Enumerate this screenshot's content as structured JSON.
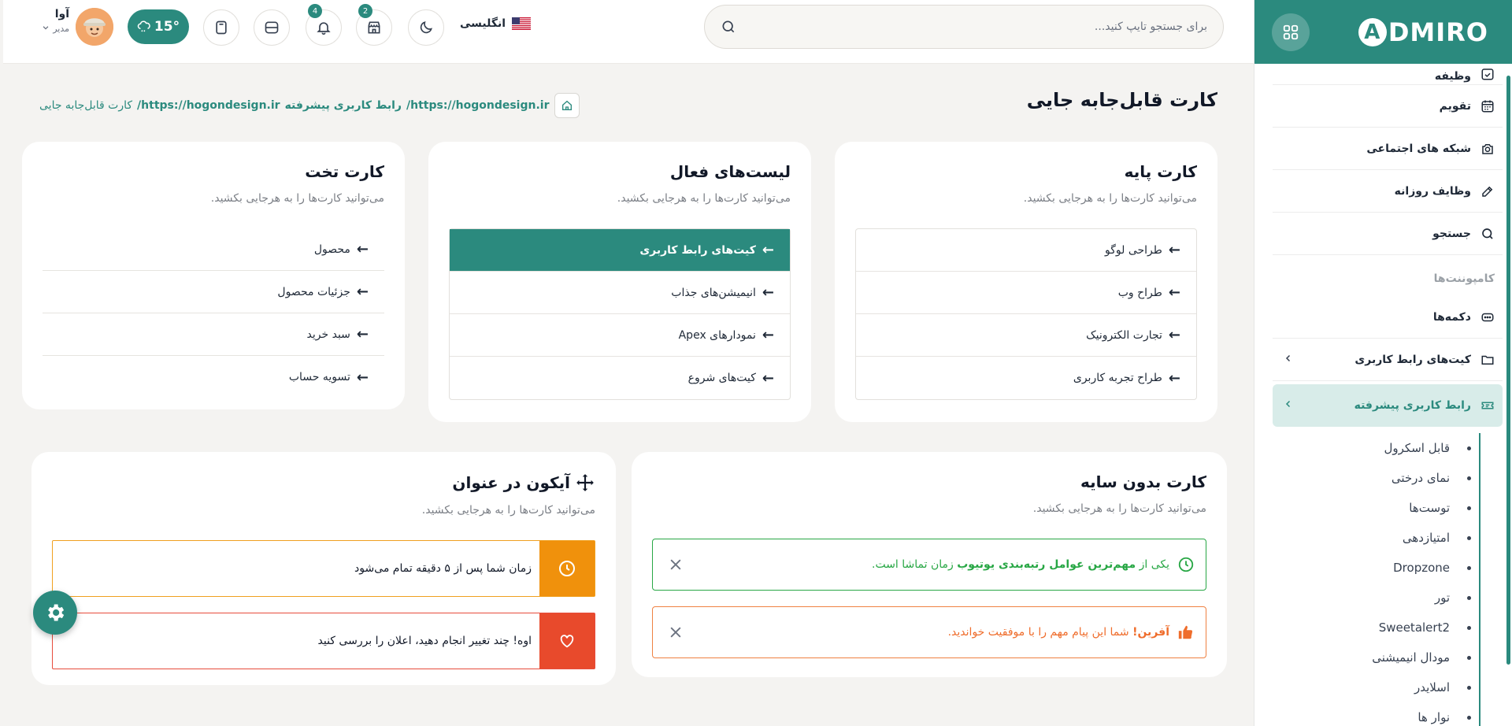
{
  "brand": {
    "logo_text": "DMIRO",
    "logo_letter": "A",
    "accent": "#2b8a7e"
  },
  "sidebar": {
    "items_top": [
      {
        "label": "وظیفه",
        "icon": "calendar-check-icon"
      },
      {
        "label": "تقویم",
        "icon": "calendar-icon"
      },
      {
        "label": "شبکه های اجتماعی",
        "icon": "camera-icon"
      },
      {
        "label": "وظایف روزانه",
        "icon": "edit-icon"
      },
      {
        "label": "جستجو",
        "icon": "search-icon"
      }
    ],
    "section_label": "کامپوننت‌ها",
    "items_components": [
      {
        "label": "دکمه‌ها",
        "icon": "button-icon"
      },
      {
        "label": "کیت‌های رابط کاربری",
        "icon": "folder-icon"
      },
      {
        "label": "رابط کاربری پیشرفته",
        "icon": "ticket-icon"
      }
    ],
    "sub_items": [
      "قابل اسکرول",
      "نمای درختی",
      "توست‌ها",
      "امتیازدهی",
      "Dropzone",
      "تور",
      "Sweetalert2",
      "مودال انیمیشنی",
      "اسلایدر",
      "نوار ها"
    ]
  },
  "topbar": {
    "search_placeholder": "برای جستجو تایپ کنید...",
    "language": "انگلیسی",
    "notifications_count": "4",
    "store_count": "2",
    "weather": "15°",
    "user_name": "آوا",
    "user_role": "مدیر"
  },
  "page": {
    "title": "کارت قابل‌جابه جایی",
    "breadcrumb": [
      "https://hogondesign.ir/",
      "رابط کاربری پیشرفته",
      "https://hogondesign.ir/",
      "کارت قابل‌جابه جایی"
    ]
  },
  "cards": {
    "basic": {
      "title": "کارت پایه",
      "subtitle": "می‌توانید کارت‌ها را به هرجایی بکشید.",
      "items": [
        "طراحی لوگو",
        "طراح وب",
        "تجارت الکترونیک",
        "طراح تجربه کاربری"
      ]
    },
    "active": {
      "title": "لیست‌های فعال",
      "subtitle": "می‌توانید کارت‌ها را به هرجایی بکشید.",
      "items": [
        "کیت‌های رابط کاربری",
        "انیمیشن‌های جذاب",
        "نمودارهای Apex",
        "کیت‌های شروع"
      ]
    },
    "flat": {
      "title": "کارت تخت",
      "subtitle": "می‌توانید کارت‌ها را به هرجایی بکشید.",
      "items": [
        "محصول",
        "جزئیات محصول",
        "سبد خرید",
        "تسویه حساب"
      ]
    },
    "no_shadow": {
      "title": "کارت بدون سایه",
      "subtitle": "می‌توانید کارت‌ها را به هرجایی بکشید.",
      "alert1_pre": "یکی از",
      "alert1_bold": "مهم‌ترین عوامل رتبه‌بندی یوتیوب",
      "alert1_post": "زمان تماشا است.",
      "alert2_bold": "آفرین!",
      "alert2_text": "شما این پیام مهم را با موفقیت خواندید."
    },
    "icon_title": {
      "title": "آیکون در عنوان",
      "subtitle": "می‌توانید کارت‌ها را به هرجایی بکشید.",
      "alert1": "زمان شما پس از ۵ دقیقه تمام می‌شود",
      "alert2": "اوه! چند تغییر انجام دهید، اعلان را بررسی کنید"
    }
  }
}
